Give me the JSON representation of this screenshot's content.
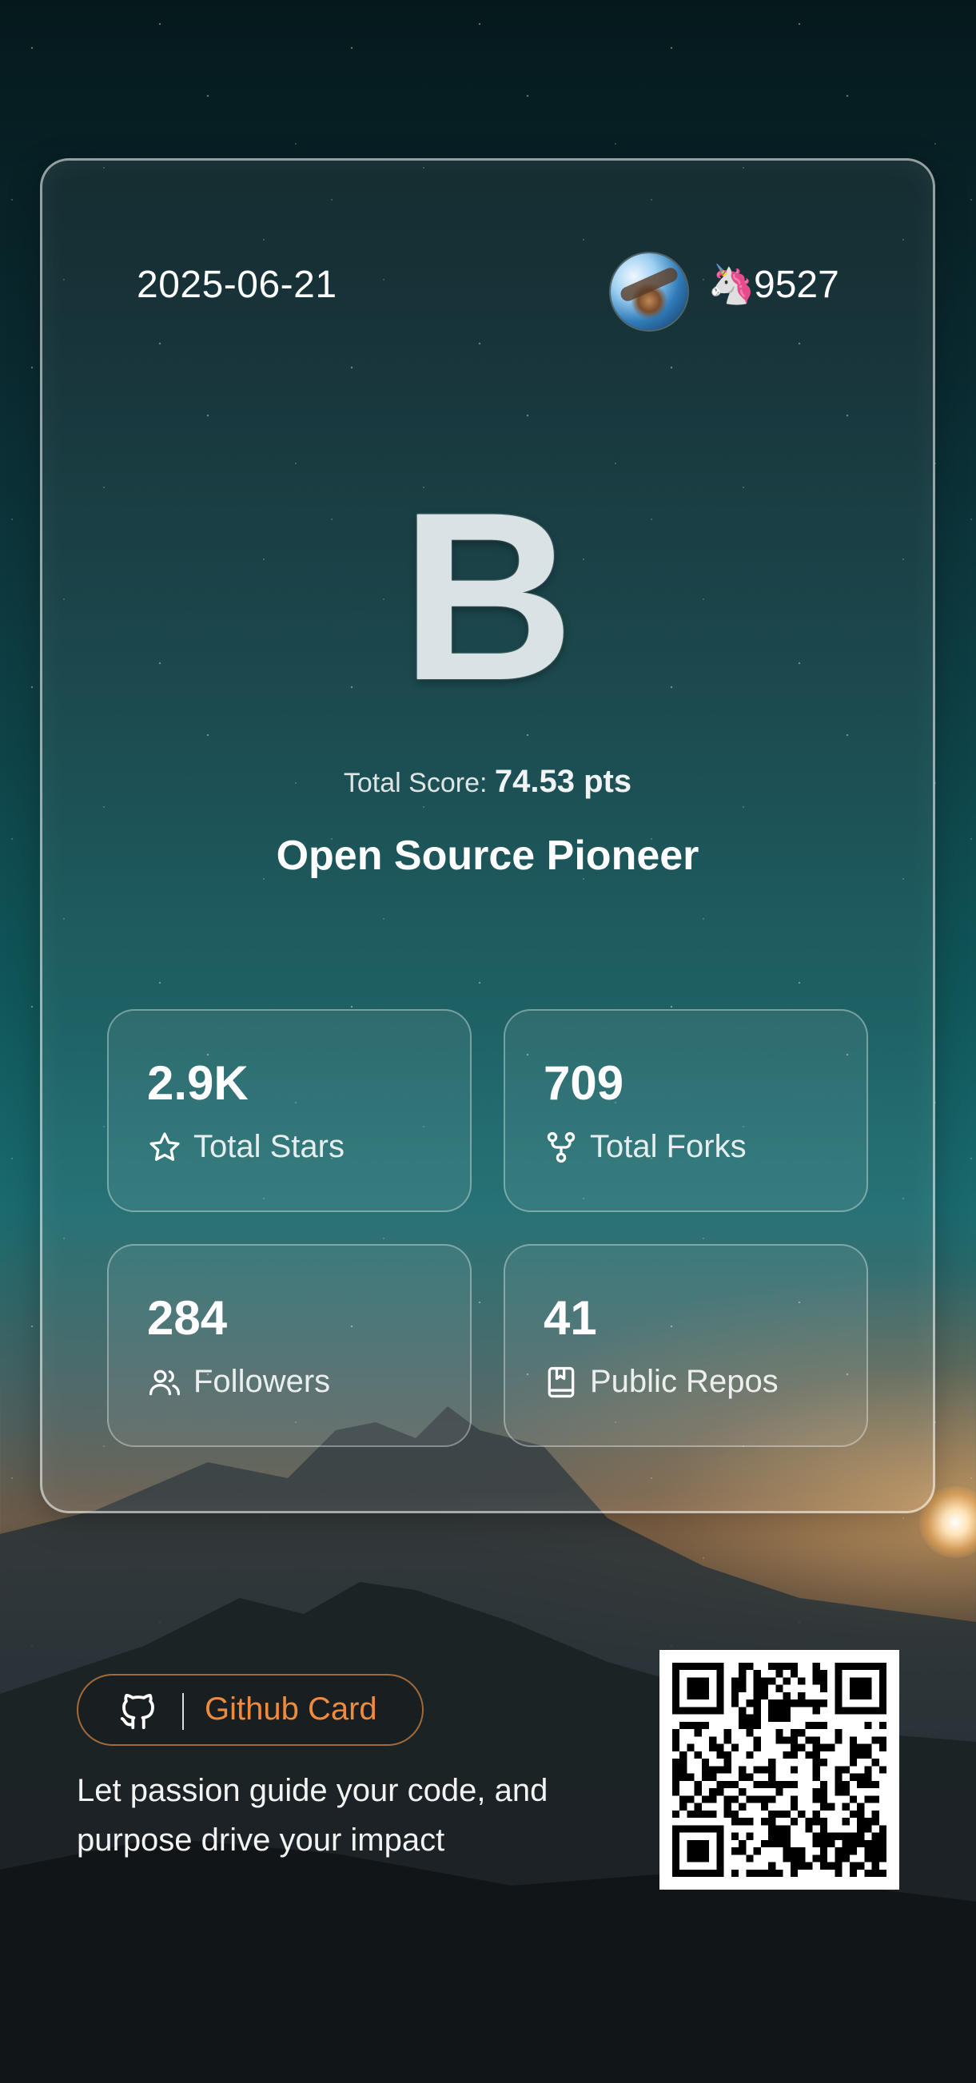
{
  "card": {
    "date": "2025-06-21",
    "unicorn_icon": "🦄",
    "points": "9527",
    "grade": "B",
    "score_label": "Total Score:",
    "score_value": "74.53 pts",
    "title": "Open Source Pioneer"
  },
  "stats": [
    {
      "value": "2.9K",
      "label": "Total Stars",
      "icon": "star-icon"
    },
    {
      "value": "709",
      "label": "Total Forks",
      "icon": "fork-icon"
    },
    {
      "value": "284",
      "label": "Followers",
      "icon": "users-icon"
    },
    {
      "value": "41",
      "label": "Public Repos",
      "icon": "repo-icon"
    }
  ],
  "footer": {
    "brand": "Github Card",
    "brand_icon": "github-icon",
    "tagline_line1": "Let passion guide your code, and",
    "tagline_line2": "purpose drive your impact",
    "accent_color": "#f08a3c"
  }
}
